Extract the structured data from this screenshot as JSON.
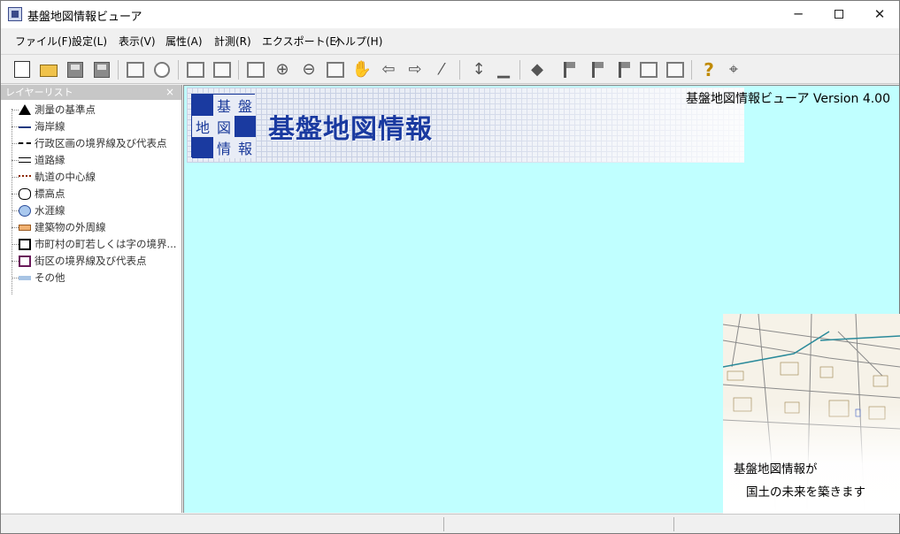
{
  "window": {
    "title": "基盤地図情報ビューア"
  },
  "menu": [
    "ファイル(F)",
    "設定(L)",
    "表示(V)",
    "属性(A)",
    "計測(R)",
    "エクスポート(E)",
    "ヘルプ(H)"
  ],
  "toolbar": {
    "items": [
      "new-document-icon",
      "open-folder-icon",
      "save-icon",
      "save-as-icon",
      "print-icon",
      "print-preview-icon",
      "layer-properties-icon",
      "display-settings-icon",
      "full-extent-icon",
      "zoom-in-icon",
      "zoom-out-icon",
      "zoom-window-icon",
      "pan-hand-icon",
      "previous-view-icon",
      "next-view-icon",
      "measure-icon",
      "scale-icon",
      "ruler-icon",
      "eraser-icon",
      "flag-icon",
      "flag-alt-icon",
      "flag-marker-icon",
      "area-icon",
      "export-icon",
      "help-icon",
      "context-help-icon"
    ]
  },
  "layer_panel": {
    "title": "レイヤーリスト",
    "close": "×",
    "layers": [
      {
        "label": "測量の基準点",
        "icon": "triangle-point-icon"
      },
      {
        "label": "海岸線",
        "icon": "coastline-icon"
      },
      {
        "label": "行政区画の境界線及び代表点",
        "icon": "admin-boundary-icon"
      },
      {
        "label": "道路縁",
        "icon": "road-edge-icon"
      },
      {
        "label": "軌道の中心線",
        "icon": "railway-icon"
      },
      {
        "label": "標高点",
        "icon": "elevation-point-icon"
      },
      {
        "label": "水涯線",
        "icon": "waterline-icon"
      },
      {
        "label": "建築物の外周線",
        "icon": "building-icon"
      },
      {
        "label": "市町村の町若しくは字の境界...",
        "icon": "town-boundary-icon"
      },
      {
        "label": "街区の境界線及び代表点",
        "icon": "block-boundary-icon"
      },
      {
        "label": "その他",
        "icon": "other-icon"
      }
    ]
  },
  "splash": {
    "logo_chars": [
      "基",
      "盤",
      "地",
      "図",
      "情",
      "報"
    ],
    "title": "基盤地図情報",
    "version": "基盤地図情報ビューア Version 4.00",
    "tagline1": "基盤地図情報が",
    "tagline2": "国土の未来を築きます"
  },
  "colors": {
    "map_background": "#c0ffff",
    "logo_blue": "#1a3aa0"
  }
}
